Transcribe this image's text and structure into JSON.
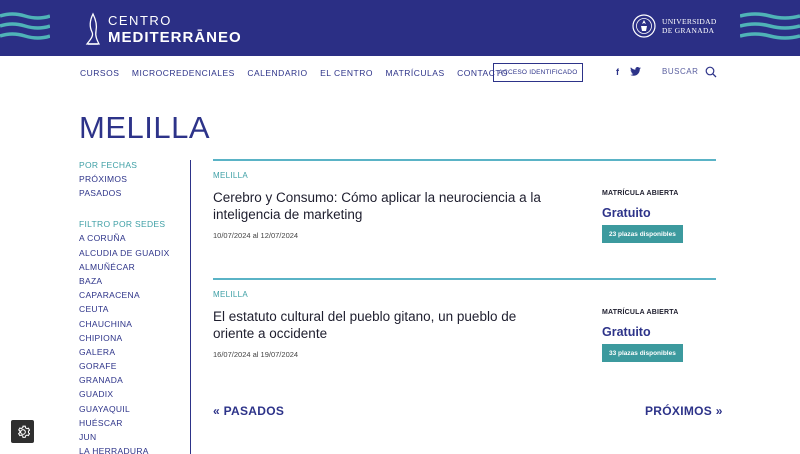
{
  "header": {
    "logo_line1": "CENTRO",
    "logo_line2": "MEDITERRĀNEO",
    "university_line1": "UNIVERSIDAD",
    "university_line2": "DE GRANADA",
    "bg_color": "#2b2f85"
  },
  "nav": {
    "items": [
      "CURSOS",
      "MICROCREDENCIALES",
      "CALENDARIO",
      "EL CENTRO",
      "MATRÍCULAS",
      "CONTACTO"
    ],
    "acceso_label": "ACCESO IDENTIFICADO",
    "facebook_icon": "f",
    "twitter_icon": "twitter-icon",
    "search_label": "BUSCAR"
  },
  "page_title": "MELILLA",
  "sidebar": {
    "fechas_heading": "POR FECHAS",
    "fechas": [
      "PRÓXIMOS",
      "PASADOS"
    ],
    "sedes_heading": "FILTRO POR SEDES",
    "sedes": [
      "A CORUÑA",
      "ALCUDIA DE GUADIX",
      "ALMUÑÉCAR",
      "BAZA",
      "CAPARACENA",
      "CEUTA",
      "CHAUCHINA",
      "CHIPIONA",
      "GALERA",
      "GORAFE",
      "GRANADA",
      "GUADIX",
      "GUAYAQUIL",
      "HUÉSCAR",
      "JUN",
      "LA HERRADURA"
    ]
  },
  "courses": [
    {
      "place": "MELILLA",
      "title": "Cerebro y Consumo: Cómo aplicar la neurociencia a la inteligencia de marketing",
      "dates": "10/07/2024 al 12/07/2024",
      "status": "MATRÍCULA ABIERTA",
      "price": "Gratuito",
      "badge": "23 plazas disponibles"
    },
    {
      "place": "MELILLA",
      "title": "El estatuto cultural del pueblo gitano, un pueblo de oriente a occidente",
      "dates": "16/07/2024 al 19/07/2024",
      "status": "MATRÍCULA ABIERTA",
      "price": "Gratuito",
      "badge": "33 plazas disponibles"
    }
  ],
  "pager": {
    "prev": "« PASADOS",
    "next": "PRÓXIMOS »"
  },
  "colors": {
    "primary": "#2d3389",
    "accent_teal": "#3fa0a6",
    "badge_bg": "#3c9a9e",
    "wave_color": "#4fb3b7"
  }
}
